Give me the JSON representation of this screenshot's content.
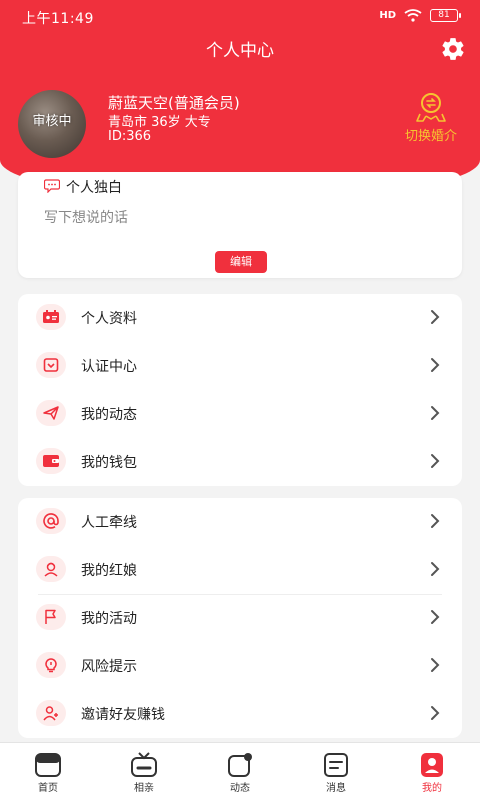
{
  "status_bar": {
    "time": "上午11:49",
    "signal": "HD",
    "battery": "81"
  },
  "header": {
    "title": "个人中心"
  },
  "profile": {
    "avatar_badge": "审核中",
    "name": "蔚蓝天空(普通会员)",
    "meta": "青岛市 36岁 大专",
    "id": "ID:366",
    "switch_label": "切换婚介"
  },
  "monologue": {
    "title": "个人独白",
    "placeholder": "写下想说的话",
    "edit_label": "编辑"
  },
  "menu_group_1": [
    {
      "label": "个人资料",
      "icon": "profile-card-icon"
    },
    {
      "label": "认证中心",
      "icon": "shield-check-icon"
    },
    {
      "label": "我的动态",
      "icon": "paper-plane-icon"
    },
    {
      "label": "我的钱包",
      "icon": "wallet-icon"
    }
  ],
  "menu_group_2": [
    {
      "label": "人工牵线",
      "icon": "at-sign-icon"
    },
    {
      "label": "我的红娘",
      "icon": "matchmaker-icon"
    },
    {
      "label": "我的活动",
      "icon": "flag-icon"
    },
    {
      "label": "风险提示",
      "icon": "lightbulb-icon"
    },
    {
      "label": "邀请好友赚钱",
      "icon": "add-user-icon"
    }
  ],
  "tabs": [
    {
      "label": "首页",
      "icon": "home-icon"
    },
    {
      "label": "相亲",
      "icon": "tv-icon"
    },
    {
      "label": "动态",
      "icon": "moments-icon"
    },
    {
      "label": "消息",
      "icon": "message-icon"
    },
    {
      "label": "我的",
      "icon": "person-icon",
      "active": true
    }
  ],
  "colors": {
    "brand": "#f0303d",
    "accent_gold": "#f6c430",
    "icon_bg": "#fdeceb"
  }
}
